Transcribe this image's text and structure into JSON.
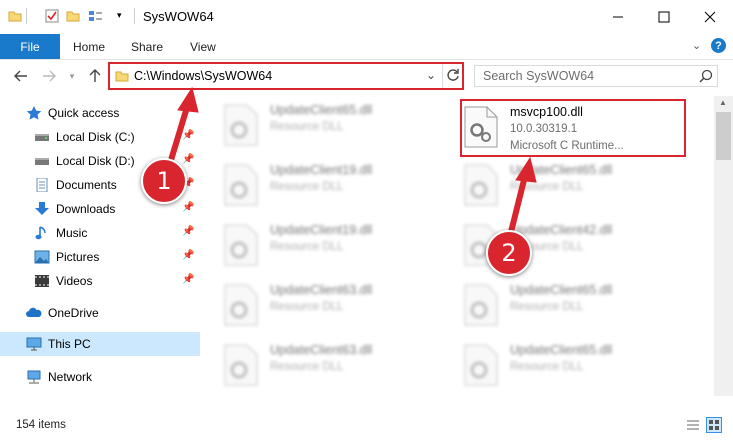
{
  "window": {
    "title": "SysWOW64"
  },
  "ribbon": {
    "tabs": [
      "File",
      "Home",
      "Share",
      "View"
    ]
  },
  "address": {
    "path": "C:\\Windows\\SysWOW64"
  },
  "search": {
    "placeholder": "Search SysWOW64"
  },
  "sidebar": {
    "quick_access": "Quick access",
    "items": [
      {
        "label": "Local Disk (C:)",
        "icon": "drive-icon"
      },
      {
        "label": "Local Disk (D:)",
        "icon": "drive-icon"
      },
      {
        "label": "Documents",
        "icon": "documents-icon"
      },
      {
        "label": "Downloads",
        "icon": "downloads-icon"
      },
      {
        "label": "Music",
        "icon": "music-icon"
      },
      {
        "label": "Pictures",
        "icon": "pictures-icon"
      },
      {
        "label": "Videos",
        "icon": "videos-icon"
      }
    ],
    "onedrive": "OneDrive",
    "this_pc": "This PC",
    "network": "Network"
  },
  "files": {
    "highlighted": {
      "name": "msvcp100.dll",
      "version": "10.0.30319.1",
      "description": "Microsoft C Runtime..."
    },
    "col1": [
      {
        "name": "UpdateClient65.dll",
        "type": "Resource DLL"
      },
      {
        "name": "UpdateClient19.dll",
        "type": "Resource DLL"
      },
      {
        "name": "UpdateClient19.dll",
        "type": "Resource DLL"
      },
      {
        "name": "UpdateClient63.dll",
        "type": "Resource DLL"
      },
      {
        "name": "UpdateClient63.dll",
        "type": "Resource DLL"
      }
    ],
    "col2": [
      {
        "name": "UpdateClient65.dll",
        "type": "Resource DLL"
      },
      {
        "name": "UpdateClient42.dll",
        "type": "Resource DLL"
      },
      {
        "name": "UpdateClient65.dll",
        "type": "Resource DLL"
      },
      {
        "name": "UpdateClient65.dll",
        "type": "Resource DLL"
      }
    ]
  },
  "status": {
    "item_count": "154 items"
  },
  "callouts": [
    "1",
    "2"
  ],
  "colors": {
    "accent": "#1979ca",
    "annotation_red": "#d9262e",
    "selection": "#cce8ff"
  }
}
